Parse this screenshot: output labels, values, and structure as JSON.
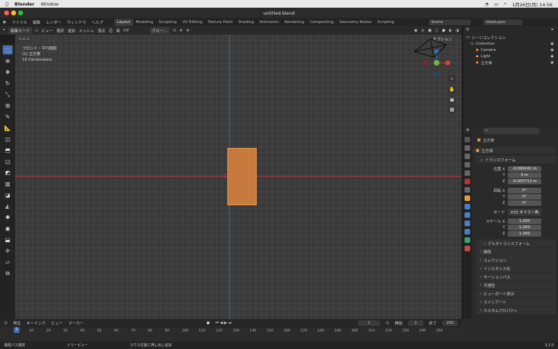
{
  "macbar": {
    "app": "Blender",
    "menu": "Window",
    "date_time": "1月26日(月) 14:56"
  },
  "window": {
    "title": "untitled.blend"
  },
  "menubar": {
    "items": [
      "ファイル",
      "編集",
      "レンダー",
      "ウィンドウ",
      "ヘルプ"
    ],
    "workspaces": [
      "Layout",
      "Modeling",
      "Sculpting",
      "UV Editing",
      "Texture Paint",
      "Shading",
      "Animation",
      "Rendering",
      "Compositing",
      "Geometry Nodes",
      "Scripting"
    ],
    "scene": "Scene",
    "viewlayer": "ViewLayer"
  },
  "header3d": {
    "mode": "編集モード",
    "menus": [
      "ビュー",
      "選択",
      "追加",
      "メッシュ",
      "頂点",
      "辺",
      "面",
      "UV"
    ],
    "transform_orient": "グロー…",
    "options": "オプション"
  },
  "viewport": {
    "view_name": "フロント・平行投影",
    "object_label": "(1) 立方体",
    "scale_label": "10 Centimeters"
  },
  "outliner": {
    "root": "シーンコレクション",
    "collection": "Collection",
    "objects": [
      "Camera",
      "Light",
      "立方体"
    ]
  },
  "properties": {
    "object_name": "立方体",
    "data_name": "立方体",
    "transform_title": "トランスフォーム",
    "location_label": "位置 X",
    "location": [
      "-0.099241 m",
      "0 m",
      "-0.005712 m"
    ],
    "rotation_label": "回転 X",
    "rotation": [
      "0°",
      "0°",
      "0°"
    ],
    "mode_label": "モード",
    "mode_value": "XYZ オイラー角",
    "scale_label": "スケール X",
    "scale": [
      "1.000",
      "1.000",
      "1.000"
    ],
    "axis_y": "Y",
    "axis_z": "Z",
    "sections": [
      "デルタトランスフォーム",
      "関係",
      "コレクション",
      "インスタンス化",
      "モーションパス",
      "可視性",
      "ビューポート表示",
      "ラインアート",
      "カスタムプロパティ"
    ]
  },
  "timeline": {
    "menus": [
      "再生",
      "キーイング",
      "ビュー",
      "マーカー"
    ],
    "current_frame": "1",
    "start_label": "開始",
    "start": "1",
    "end_label": "終了",
    "end": "250",
    "ticks": [
      "10",
      "20",
      "30",
      "40",
      "50",
      "60",
      "70",
      "80",
      "90",
      "100",
      "110",
      "120",
      "130",
      "140",
      "150",
      "160",
      "170",
      "180",
      "190",
      "200",
      "210",
      "220",
      "230",
      "240",
      "250"
    ]
  },
  "statusbar": {
    "left": "最短パス選択",
    "middle": "ドリーピュー",
    "right": "マウス位置に押し出し追加",
    "version": "3.2.0"
  },
  "colors": {
    "accent": "#4772b3",
    "selection": "#f0a04a"
  }
}
